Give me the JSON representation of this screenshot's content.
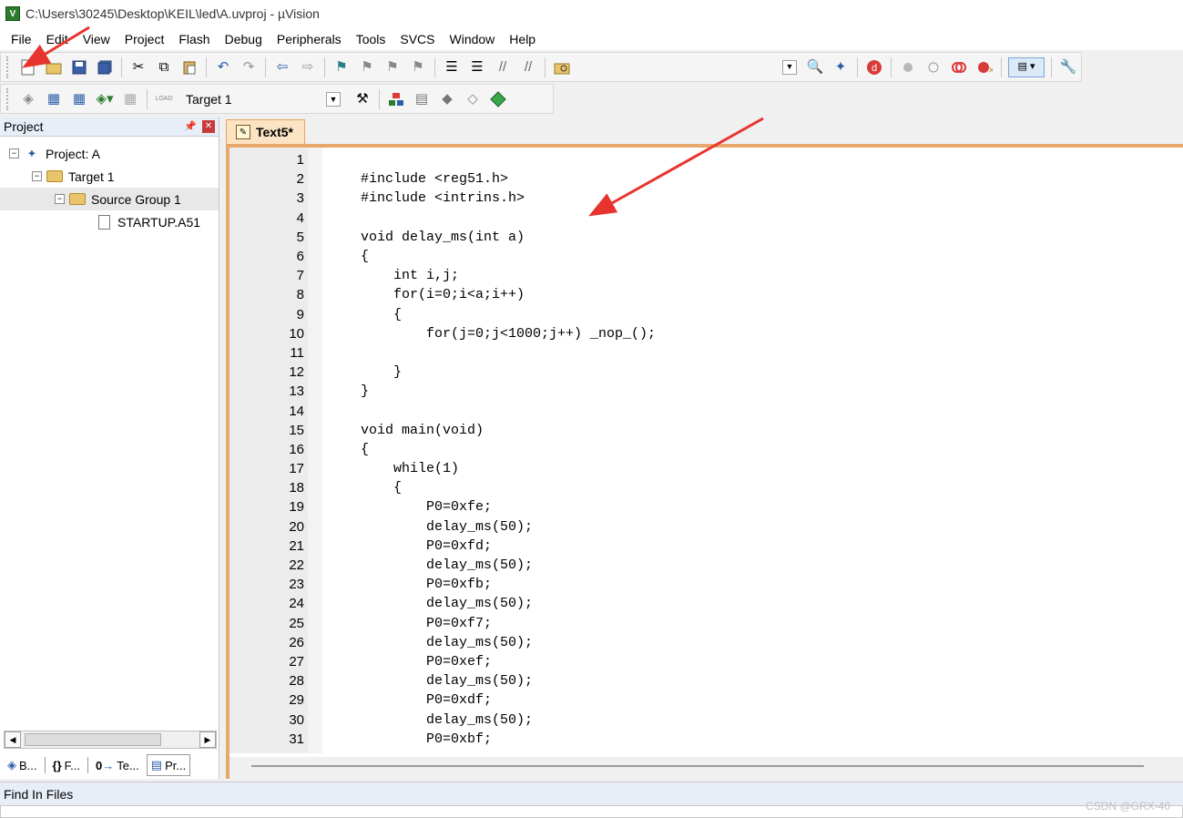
{
  "window": {
    "title": "C:\\Users\\30245\\Desktop\\KEIL\\led\\A.uvproj - µVision",
    "app_icon_text": "V"
  },
  "menu": [
    "File",
    "Edit",
    "View",
    "Project",
    "Flash",
    "Debug",
    "Peripherals",
    "Tools",
    "SVCS",
    "Window",
    "Help"
  ],
  "toolbar2": {
    "load_label": "LOAD",
    "target": "Target 1"
  },
  "project_panel": {
    "title": "Project",
    "tree": [
      {
        "label": "Project: A",
        "level": 0
      },
      {
        "label": "Target 1",
        "level": 1
      },
      {
        "label": "Source Group 1",
        "level": 2
      },
      {
        "label": "STARTUP.A51",
        "level": 3
      }
    ],
    "bottom_tabs": [
      "B...",
      "F...",
      "Te...",
      "Pr..."
    ]
  },
  "editor": {
    "tab_label": "Text5*",
    "line_numbers": [
      "1",
      "2",
      "3",
      "4",
      "5",
      "6",
      "7",
      "8",
      "9",
      "10",
      "11",
      "12",
      "13",
      "14",
      "15",
      "16",
      "17",
      "18",
      "19",
      "20",
      "21",
      "22",
      "23",
      "24",
      "25",
      "26",
      "27",
      "28",
      "29",
      "30",
      "31"
    ],
    "lines": [
      "",
      "#include <reg51.h>",
      "#include <intrins.h>",
      "",
      "void delay_ms(int a)",
      "{",
      "    int i,j;",
      "    for(i=0;i<a;i++)",
      "    {",
      "        for(j=0;j<1000;j++) _nop_();",
      "",
      "    }",
      "}",
      "",
      "void main(void)",
      "{",
      "    while(1)",
      "    {",
      "        P0=0xfe;",
      "        delay_ms(50);",
      "        P0=0xfd;",
      "        delay_ms(50);",
      "        P0=0xfb;",
      "        delay_ms(50);",
      "        P0=0xf7;",
      "        delay_ms(50);",
      "        P0=0xef;",
      "        delay_ms(50);",
      "        P0=0xdf;",
      "        delay_ms(50);",
      "        P0=0xbf;"
    ]
  },
  "find_panel": {
    "title": "Find In Files"
  },
  "watermark": "CSDN @GRX-40",
  "colors": {
    "tab_accent": "#e8a86c",
    "annotation_arrow": "#e8342e"
  }
}
